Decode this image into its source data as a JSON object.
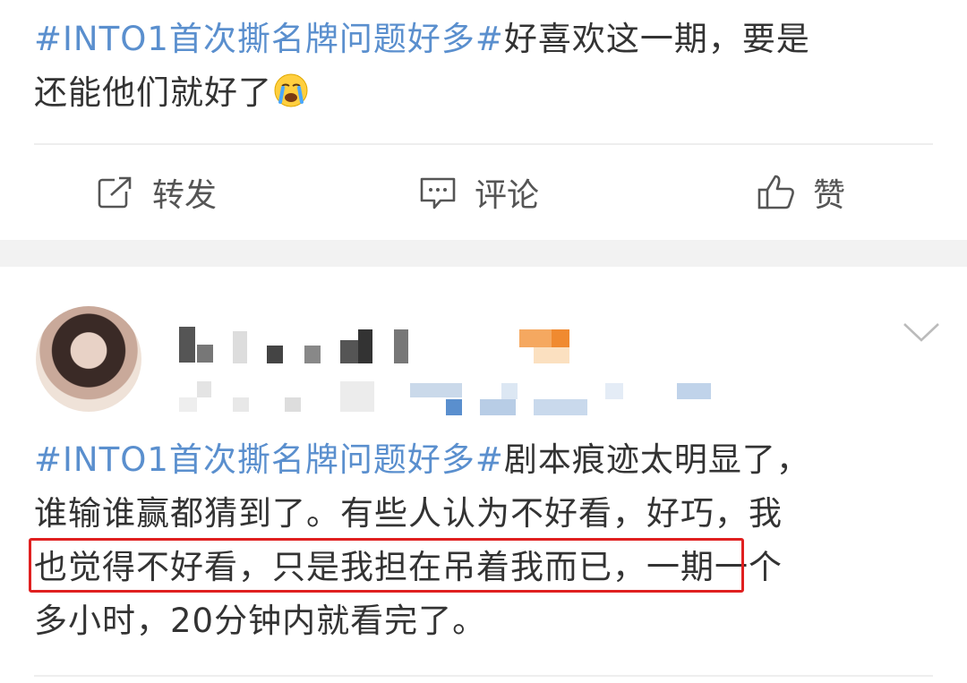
{
  "post1": {
    "topic": "#INTO1首次撕名牌问题好多#",
    "text_a": "好喜欢这一期，要是",
    "text_b": "还能他们就好了",
    "emoji": "crying-face-emoji"
  },
  "actions": {
    "repost_label": "转发",
    "comment_label": "评论",
    "like_label": "赞",
    "repost_icon": "share-icon",
    "comment_icon": "comment-icon",
    "like_icon": "thumbs-up-icon"
  },
  "post2": {
    "topic": "#INTO1首次撕名牌问题好多#",
    "line1": "剧本痕迹太明显了，",
    "line2": "谁输谁赢都猜到了。有些人认为不好看，好巧，我",
    "line3_highlight": "也觉得不好看，只是我担在吊着我而已，",
    "line3_rest": "一期一个",
    "line4": "多小时，20分钟内就看完了。"
  },
  "colors": {
    "topic_link": "#5a8fce",
    "text": "#333333",
    "highlight_border": "#e02020",
    "separator_band": "#f2f2f2"
  }
}
